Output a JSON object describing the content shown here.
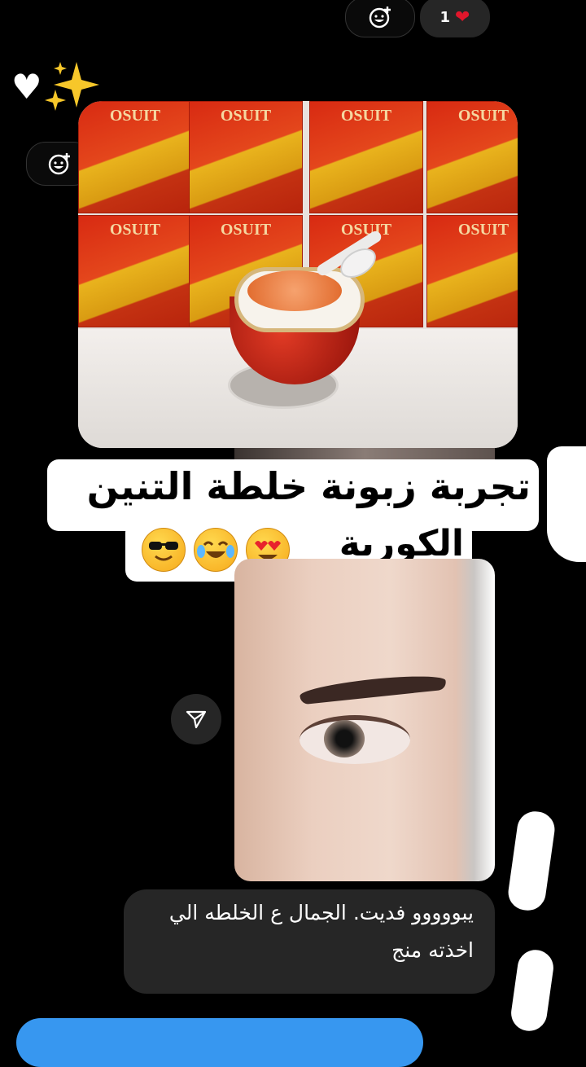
{
  "reactions": {
    "count": "1",
    "heart_icon": "heart-icon",
    "add_reaction_icon": "add-reaction-icon"
  },
  "story_caption": {
    "line1": "تجربة زبونة خلطة التنين",
    "line2": "الكورية"
  },
  "product_photo": {
    "brand": "OSUIT"
  },
  "message": {
    "line1": "يبووووو فديت. الجمال ع الخلطه الي",
    "line2": "اخذته منج"
  },
  "colors": {
    "background": "#000000",
    "bubble": "#262626",
    "accent_blue": "#3797f0",
    "heart_red": "#e0162b"
  }
}
